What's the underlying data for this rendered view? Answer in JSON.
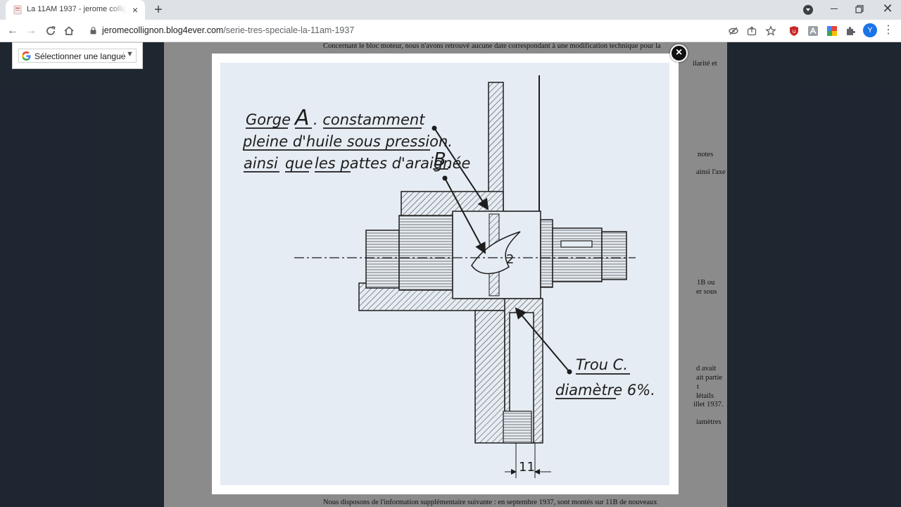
{
  "browser": {
    "tab_title": "La 11AM 1937 - jerome collignon",
    "tab_close": "×",
    "new_tab": "+",
    "url_host": "jeromecollignon.blog4ever.com",
    "url_path": "/serie-tres-speciale-la-11am-1937",
    "profile_initial": "Y",
    "window_close": "✕"
  },
  "translate_widget": {
    "label": "Sélectionner une langue",
    "caret": "▼"
  },
  "article": {
    "paragraph_1_line_1": "Concernant le bloc moteur, nous n'avons retrouvé aucune date correspondant à une modification technique pour la",
    "right_fragments": [
      "ilarité et",
      "notes",
      "ainsi l'axe",
      "1B ou",
      "er sous",
      "d avait",
      "ait partie",
      "t",
      "létails",
      "illet 1937.",
      "iamètres"
    ],
    "last_line": "Nous disposons de l'information supplémentaire suivante : en septembre 1937, sont montés sur 11B de nouveaux"
  },
  "lightbox": {
    "close_label": "×",
    "annotation": {
      "line1_part1": "Gorge",
      "line1_letter": "A",
      "line1_part2": ". constamment",
      "line2": "pleine d'huile sous pression.",
      "line3_part1": "ainsi",
      "line3_part2": "que",
      "line3_part3": "les pattes d'araignée",
      "line3_letter": "B",
      "line3_end": ".",
      "hole_label": "Trou C.",
      "hole_diameter": "diamètre 6%.",
      "dim_2": "2",
      "dim_11": "11"
    }
  },
  "colors": {
    "chrome_bg": "#dee1e6",
    "page_bg": "#344354",
    "content_bg": "#efefef",
    "drawing_bg": "#e6ecf3",
    "profile": "#1a73e8"
  }
}
